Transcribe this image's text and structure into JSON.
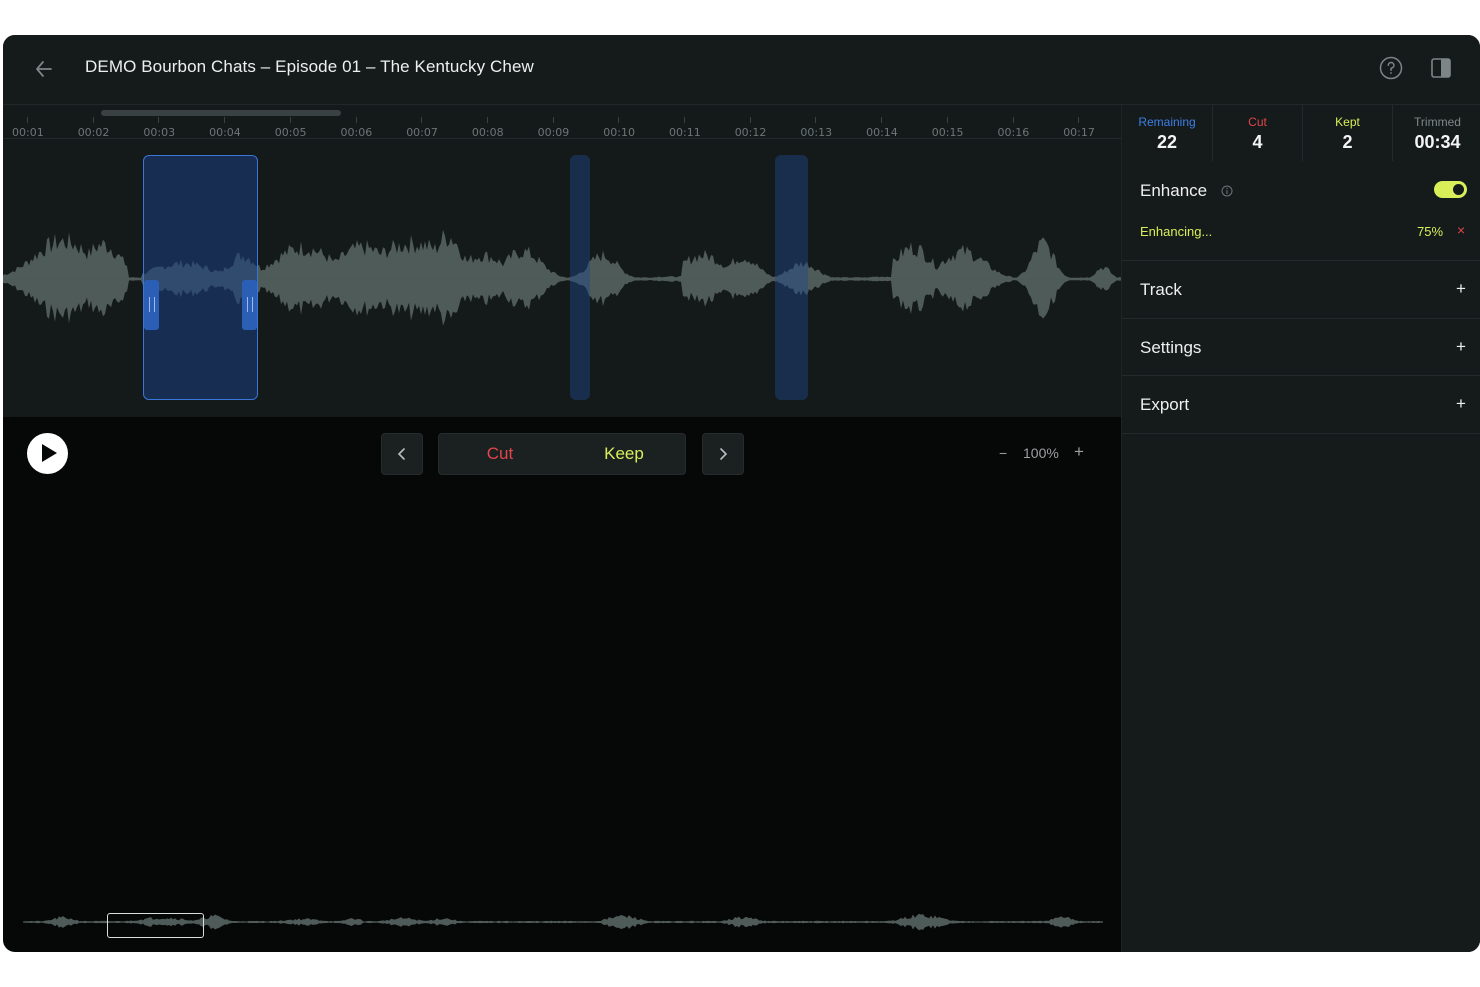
{
  "header": {
    "title": "DEMO Bourbon Chats – Episode 01 – The Kentucky Chew"
  },
  "timeline": {
    "ticks": [
      "00:01",
      "00:02",
      "00:03",
      "00:04",
      "00:05",
      "00:06",
      "00:07",
      "00:08",
      "00:09",
      "00:10",
      "00:11",
      "00:12",
      "00:13",
      "00:14",
      "00:15",
      "00:16",
      "00:17"
    ]
  },
  "controls": {
    "prev_icon": "chevron-left-icon",
    "next_icon": "chevron-right-icon",
    "cut_label": "Cut",
    "keep_label": "Keep",
    "zoom_minus": "−",
    "zoom_value": "100%",
    "zoom_plus": "+"
  },
  "sidebar": {
    "stats": [
      {
        "label": "Remaining",
        "value": "22",
        "color": "#3d7fe6"
      },
      {
        "label": "Cut",
        "value": "4",
        "color": "#e2454b"
      },
      {
        "label": "Kept",
        "value": "2",
        "color": "#d8ef5a"
      },
      {
        "label": "Trimmed",
        "value": "00:34",
        "color": "#7f8788"
      }
    ],
    "enhance": {
      "title": "Enhance",
      "enabled": true,
      "status": "Enhancing...",
      "progress": "75%",
      "cancel": "×"
    },
    "sections": [
      {
        "title": "Track",
        "action": "+"
      },
      {
        "title": "Settings",
        "action": "+"
      },
      {
        "title": "Export",
        "action": "+"
      }
    ]
  },
  "colors": {
    "accent_yellow": "#d8ef5a",
    "cut_red": "#e2454b",
    "region_blue": "#3a76d8"
  }
}
